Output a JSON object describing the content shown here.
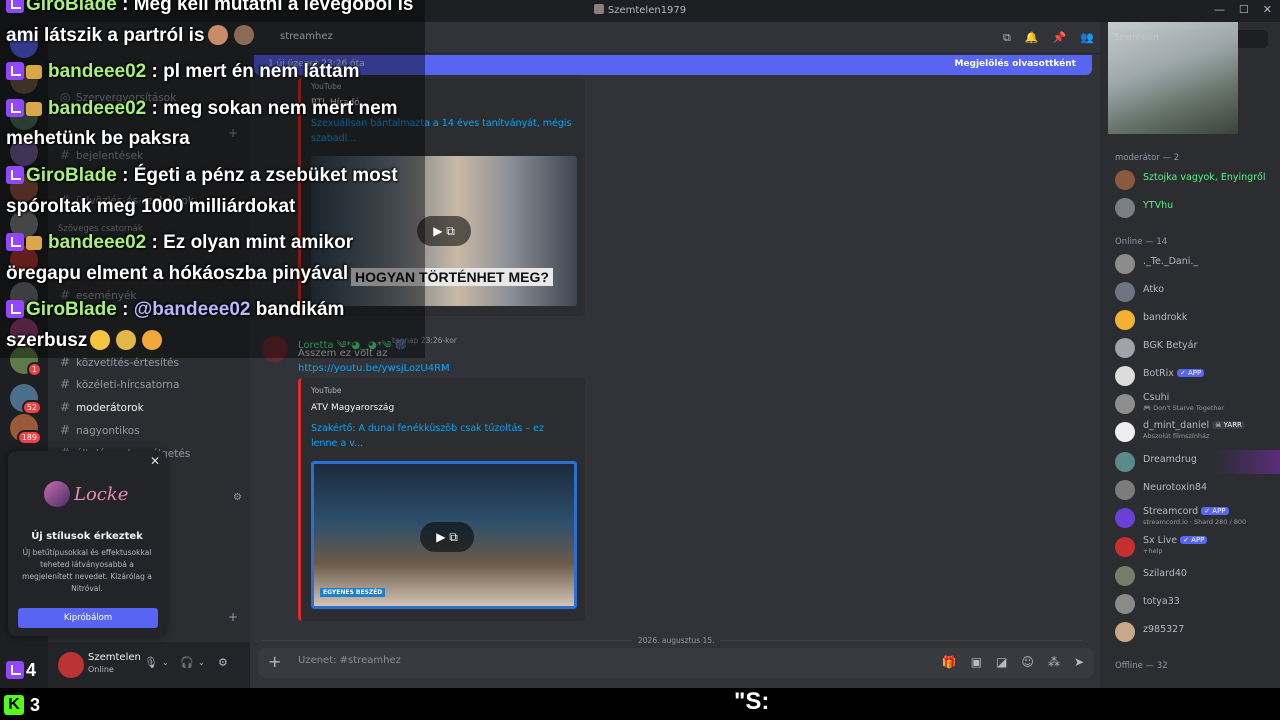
{
  "window": {
    "title": "Szemtelen1979",
    "controls": [
      "—",
      "☐",
      "✕"
    ]
  },
  "servers": [
    {
      "badge": ""
    },
    {
      "badge": ""
    },
    {
      "badge": ""
    },
    {
      "badge": ""
    },
    {
      "badge": ""
    },
    {
      "badge": ""
    },
    {
      "badge": ""
    },
    {
      "badge": ""
    },
    {
      "badge": ""
    },
    {
      "badge": "1"
    },
    {
      "badge": "52"
    },
    {
      "badge": "189"
    }
  ],
  "sidebar": {
    "server_name": "Szemtelen1979",
    "channels_top": [
      {
        "label": "Szervergyorsítások",
        "icon": "boost-icon"
      },
      {
        "label": "bejelentések",
        "icon": "hash"
      },
      {
        "label": "üdvözlés-és-szabályok",
        "icon": "hash"
      }
    ],
    "category_text": "Szöveges csatornák",
    "channels": [
      {
        "label": "eseményék",
        "active": false
      },
      {
        "label": "közvetítés-értesítés",
        "active": false
      },
      {
        "label": "közéleti-hírcsatorna",
        "active": false
      },
      {
        "label": "moderátorok",
        "active": true
      },
      {
        "label": "nagyontikos",
        "active": false
      },
      {
        "label": "általános-beszélgetés",
        "active": false
      }
    ]
  },
  "user_panel": {
    "name": "Szemtelen",
    "status": "Online"
  },
  "chat": {
    "channel_name": "streamhez",
    "unread_bar": {
      "left": "1 új üzenet 23:26 óta",
      "right": "Megjelölés olvasottként"
    },
    "embed1": {
      "provider": "YouTube",
      "author": "RTL Híradó",
      "title": "Szexuálisan bántalmazta a 14 éves tanítványát, mégis szabadl...",
      "thumb_caption": "HOGYAN TÖRTÉNHET MEG?"
    },
    "message": {
      "author": "Loretta ༄*◕‿◕*༄ 🎆",
      "timestamp": "tegnap 23:26-kor",
      "text": "Asszem ez volt az",
      "link": "https://youtu.be/ywsjLozU4RM"
    },
    "embed2": {
      "provider": "YouTube",
      "author": "ATV Magyarország",
      "title": "Szakértő: A dunai fenékküszöb csak tűzoltás – ez lenne a v...",
      "thumb_caption": "EGYENES BESZÉD"
    },
    "date_divider": "2026. augusztus 15.",
    "composer_placeholder": "Üzenet: #streamhez"
  },
  "members": {
    "search_placeholder": "Szemtelen",
    "groups": [
      {
        "header": "moderátor — 2",
        "items": [
          {
            "name": "Sztojka vagyok, Enyingről",
            "sub": "",
            "tag": "",
            "mod": true
          },
          {
            "name": "YTVhu",
            "sub": "",
            "tag": "",
            "mod": true
          }
        ]
      },
      {
        "header": "Online — 14",
        "items": [
          {
            "name": "._Te._Dani._",
            "sub": "",
            "tag": ""
          },
          {
            "name": "Atko",
            "sub": "",
            "tag": ""
          },
          {
            "name": "bandrokk",
            "sub": "",
            "tag": ""
          },
          {
            "name": "BGK Betyár",
            "sub": "",
            "tag": ""
          },
          {
            "name": "BotRix",
            "sub": "",
            "tag": "✓ APP"
          },
          {
            "name": "Csuhi",
            "sub": "🎮 Don't Starve Together",
            "tag": ""
          },
          {
            "name": "d_mint_daniel",
            "sub": "Abszolút filmszínház",
            "tag": "☠ YARR"
          },
          {
            "name": "Dreamdrug",
            "sub": "",
            "tag": "",
            "highlight": true
          },
          {
            "name": "Neurotoxin84",
            "sub": "",
            "tag": ""
          },
          {
            "name": "Streamcord",
            "sub": "streamcord.io · Shard 280 / 800",
            "tag": "✓ APP"
          },
          {
            "name": "Sx Live",
            "sub": "+help",
            "tag": "✓ APP"
          },
          {
            "name": "Szilard40",
            "sub": "",
            "tag": ""
          },
          {
            "name": "totya33",
            "sub": "",
            "tag": ""
          },
          {
            "name": "z985327",
            "sub": "",
            "tag": ""
          }
        ]
      },
      {
        "header": "Offline — 32",
        "items": []
      }
    ]
  },
  "nitro_popup": {
    "logo_text": "Locke",
    "heading": "Új stílusok érkeztek",
    "body": "Új betűtípusokkal és effektusokkal teheted látványosabbá a megjelenített nevedet. Kizárólag a Nitróval.",
    "button": "Kipróbálom"
  },
  "overlay_chat": [
    {
      "user": "GiroBlade",
      "badge_sub": false,
      "text": " : Meg kell mutatni a levegőből is",
      "color": "#a9f07a"
    },
    {
      "user": "",
      "badge_sub": false,
      "text": "ami látszik a partról is",
      "cont": true
    },
    {
      "user": "bandeee02",
      "badge_sub": true,
      "text": " : pl mert én nem láttam"
    },
    {
      "user": "bandeee02",
      "badge_sub": true,
      "text": " : meg sokan nem mert nem"
    },
    {
      "user": "",
      "badge_sub": false,
      "text": "mehetünk be paksra",
      "cont": true
    },
    {
      "user": "GiroBlade",
      "badge_sub": false,
      "text": " : Égeti a pénz a zsebüket most"
    },
    {
      "user": "",
      "badge_sub": false,
      "text": "spóroltak meg 1000 milliárdokat",
      "cont": true
    },
    {
      "user": "bandeee02",
      "badge_sub": true,
      "text": " : Ez olyan mint amikor"
    },
    {
      "user": "",
      "badge_sub": false,
      "text": "öregapu elment a hókáoszba pinyával",
      "cont": true,
      "boxed": "HOGYAN TÖRTÉNHET MEG?"
    },
    {
      "user": "GiroBlade",
      "badge_sub": false,
      "text": " : ",
      "mention": "@bandeee02",
      "tail": " bandikám"
    },
    {
      "user": "",
      "badge_sub": false,
      "text": "szerbusz",
      "cont": true
    }
  ],
  "counts": {
    "twitch": "4",
    "kick": "3",
    "kick_logo": "K"
  },
  "caption": "\"S:"
}
